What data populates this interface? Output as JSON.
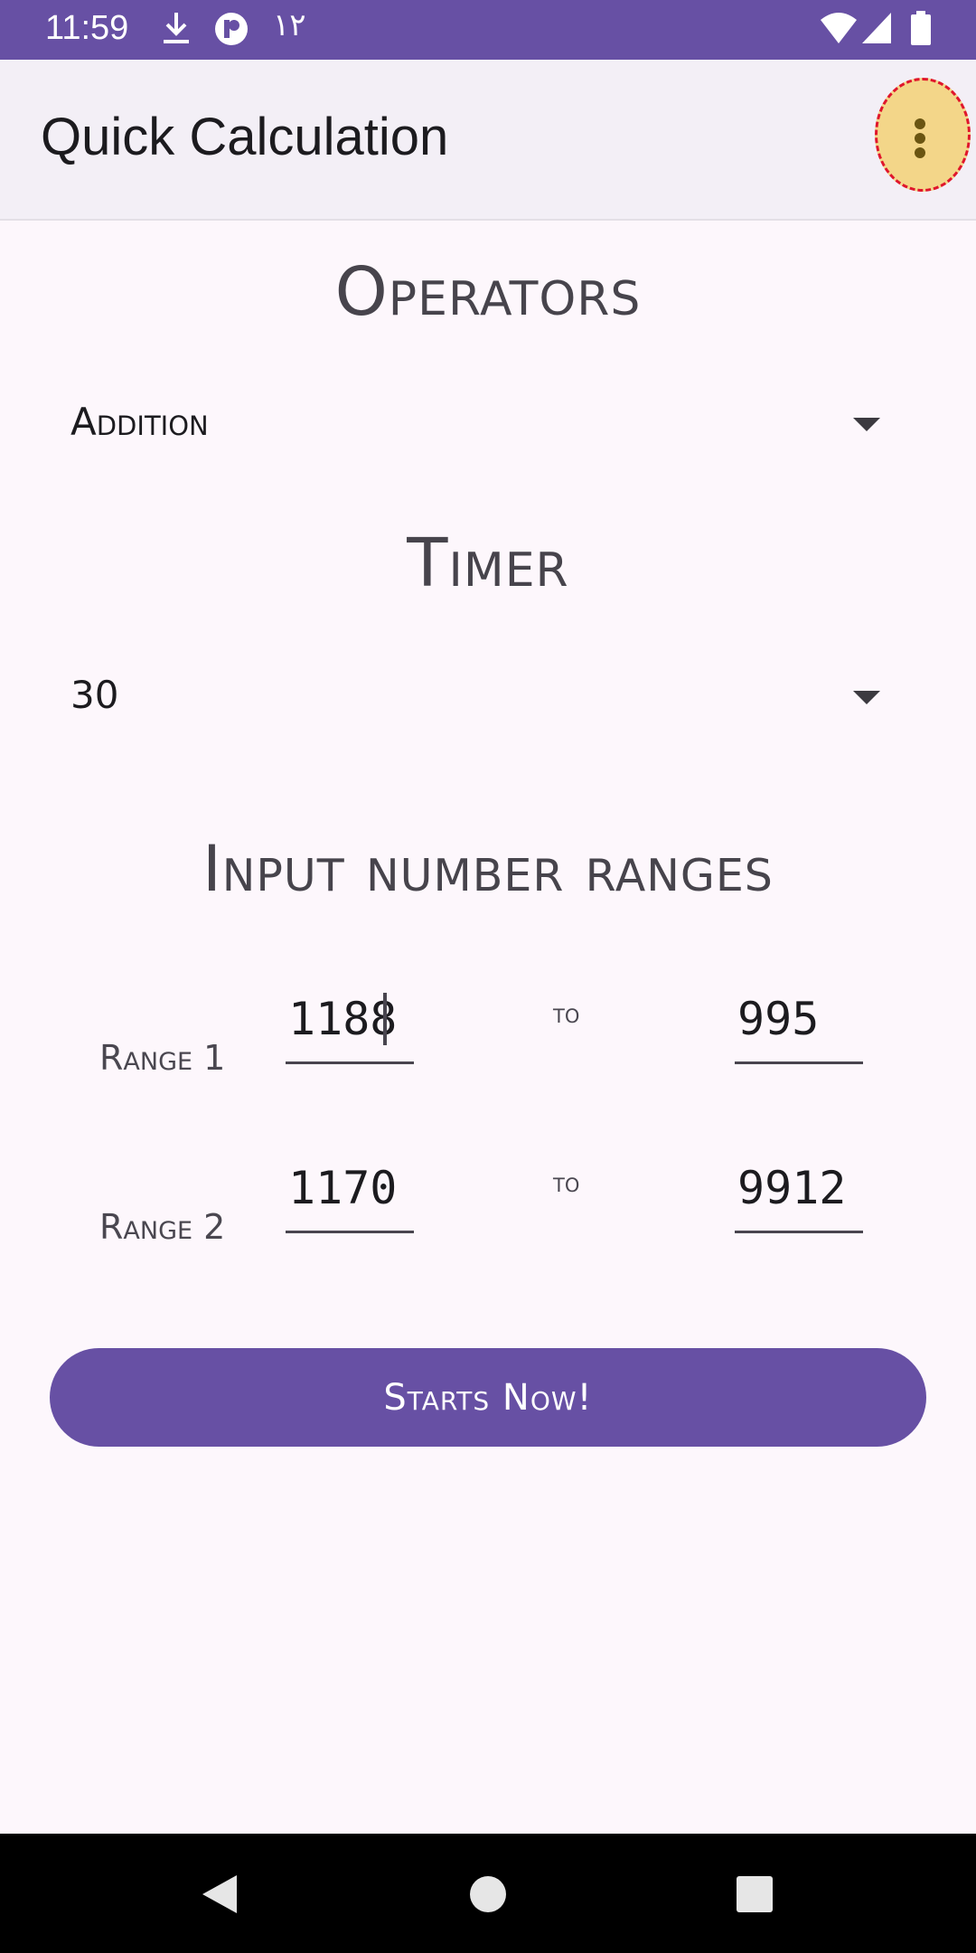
{
  "status_bar": {
    "time": "11:59",
    "extra_text": "١٢",
    "icons": [
      "download-icon",
      "app-notification-icon",
      "wifi-icon",
      "signal-icon",
      "battery-icon"
    ]
  },
  "app_bar": {
    "title": "Quick Calculation",
    "overflow_icon": "more-vert-icon"
  },
  "operators": {
    "title": "Operators",
    "selected": "Addition"
  },
  "timer": {
    "title": "Timer",
    "selected": "30"
  },
  "ranges": {
    "title": "Input number ranges",
    "to_label": "to",
    "rows": [
      {
        "label": "Range 1",
        "from": "1188",
        "to": "995"
      },
      {
        "label": "Range 2",
        "from": "1170",
        "to": "9912"
      }
    ]
  },
  "start_button": {
    "label": "Starts Now!"
  },
  "colors": {
    "primary": "#6750a4",
    "background": "#fdf7fc",
    "app_bar": "#f3eff6",
    "highlight": "#f3d689",
    "highlight_border": "#e0162b"
  }
}
